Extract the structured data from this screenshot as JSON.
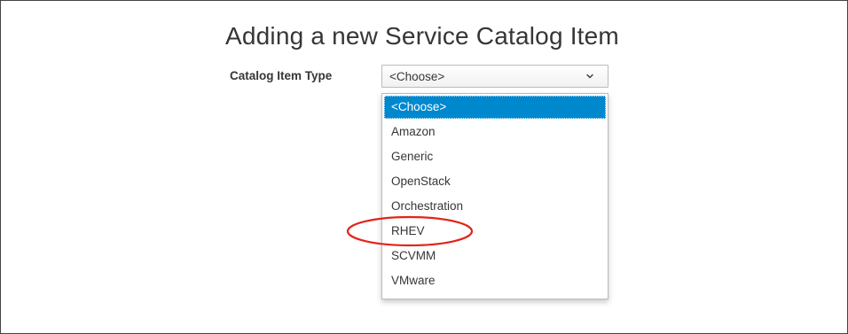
{
  "page": {
    "title": "Adding a new Service Catalog Item"
  },
  "form": {
    "catalog_item_type": {
      "label": "Catalog Item Type",
      "selected_value": "<Choose>",
      "options": [
        "<Choose>",
        "Amazon",
        "Generic",
        "OpenStack",
        "Orchestration",
        "RHEV",
        "SCVMM",
        "VMware"
      ],
      "highlighted_option": "<Choose>",
      "annotated_option": "RHEV"
    }
  },
  "colors": {
    "highlight": "#0088ce",
    "annotation": "#e0251b",
    "text": "#363636"
  },
  "icons": {
    "select_arrow": "chevron-down-icon"
  }
}
